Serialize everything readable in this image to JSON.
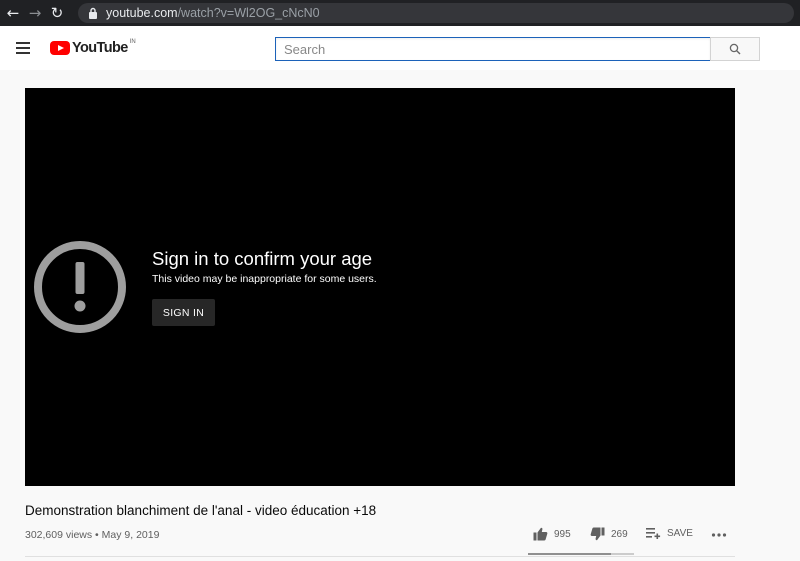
{
  "browser": {
    "url_host": "youtube.com",
    "url_path": "/watch?v=Wl2OG_cNcN0"
  },
  "masthead": {
    "logo_text": "YouTube",
    "country_code": "IN",
    "search_placeholder": "Search",
    "brand_color": "#ff0000"
  },
  "player": {
    "age_gate_title": "Sign in to confirm your age",
    "age_gate_subtitle": "This video may be inappropriate for some users.",
    "sign_in_label": "SIGN IN",
    "icon": "warning-circle-icon"
  },
  "video": {
    "title": "Demonstration blanchiment de l'anal - video éducation +18",
    "meta": "302,609 views • May 9, 2019",
    "likes": "995",
    "dislikes": "269",
    "save_label": "SAVE",
    "like_ratio": 0.787
  }
}
